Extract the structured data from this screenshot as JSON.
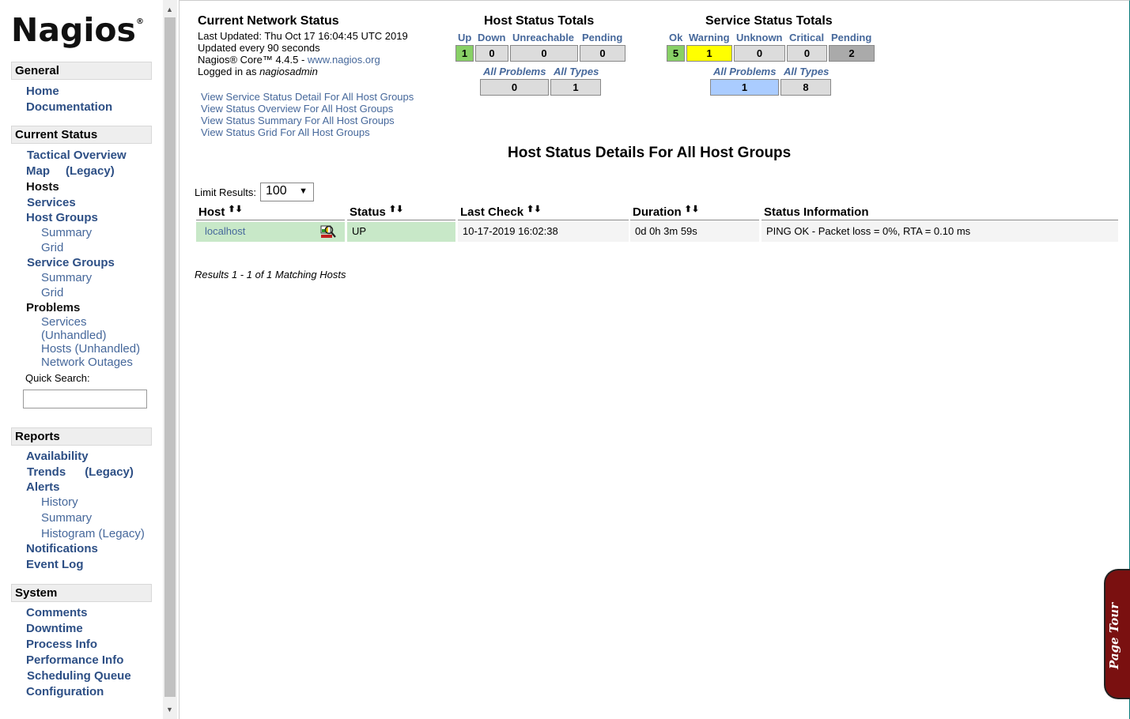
{
  "logo": {
    "text": "Nagios",
    "reg": "®"
  },
  "sidebar": {
    "general": {
      "header": "General",
      "items": [
        "Home",
        "Documentation"
      ]
    },
    "current_status": {
      "header": "Current Status",
      "tactical": "Tactical Overview",
      "map": "Map",
      "map_legacy": "(Legacy)",
      "hosts": "Hosts",
      "services": "Services",
      "host_groups": "Host Groups",
      "hg_summary": "Summary",
      "hg_grid": "Grid",
      "service_groups": "Service Groups",
      "sg_summary": "Summary",
      "sg_grid": "Grid",
      "problems": "Problems",
      "p_services": "Services",
      "p_unhandled": "(Unhandled)",
      "p_hosts": "Hosts (Unhandled)",
      "p_outages": "Network Outages",
      "quick_search": "Quick Search:"
    },
    "reports": {
      "header": "Reports",
      "availability": "Availability",
      "trends": "Trends",
      "trends_legacy": "(Legacy)",
      "alerts": "Alerts",
      "history": "History",
      "summary": "Summary",
      "histogram": "Histogram (Legacy)",
      "notifications": "Notifications",
      "event_log": "Event Log"
    },
    "system": {
      "header": "System",
      "comments": "Comments",
      "downtime": "Downtime",
      "process_info": "Process Info",
      "performance_info": "Performance Info",
      "scheduling_queue": "Scheduling Queue",
      "configuration": "Configuration"
    }
  },
  "info": {
    "title": "Current Network Status",
    "last_updated": "Last Updated: Thu Oct 17 16:04:45 UTC 2019",
    "update_interval": "Updated every 90 seconds",
    "version_prefix": "Nagios® Core™ 4.4.5 - ",
    "version_link": "www.nagios.org",
    "logged_prefix": "Logged in as ",
    "user": "nagiosadmin",
    "links": [
      "View Service Status Detail For All Host Groups",
      "View Status Overview For All Host Groups",
      "View Status Summary For All Host Groups",
      "View Status Grid For All Host Groups"
    ]
  },
  "host_totals": {
    "title": "Host Status Totals",
    "labels": {
      "up": "Up",
      "down": "Down",
      "unreachable": "Unreachable",
      "pending": "Pending"
    },
    "values": {
      "up": "1",
      "down": "0",
      "unreachable": "0",
      "pending": "0"
    },
    "all_problems_label": "All Problems",
    "all_types_label": "All Types",
    "all_problems": "0",
    "all_types": "1"
  },
  "service_totals": {
    "title": "Service Status Totals",
    "labels": {
      "ok": "Ok",
      "warning": "Warning",
      "unknown": "Unknown",
      "critical": "Critical",
      "pending": "Pending"
    },
    "values": {
      "ok": "5",
      "warning": "1",
      "unknown": "0",
      "critical": "0",
      "pending": "2"
    },
    "all_problems_label": "All Problems",
    "all_types_label": "All Types",
    "all_problems": "1",
    "all_types": "8"
  },
  "details": {
    "heading": "Host Status Details For All Host Groups",
    "limit_label": "Limit Results:",
    "limit_value": "100",
    "columns": {
      "host": "Host",
      "status": "Status",
      "last_check": "Last Check",
      "duration": "Duration",
      "info": "Status Information"
    },
    "rows": [
      {
        "host": "localhost",
        "status": "UP",
        "last_check": "10-17-2019 16:02:38",
        "duration": "0d 0h 3m 59s",
        "info": "PING OK - Packet loss = 0%, RTA = 0.10 ms"
      }
    ],
    "results": "Results 1 - 1 of 1 Matching Hosts"
  },
  "tour": "Page Tour",
  "colors": {
    "link": "#46689b",
    "nav": "#2d4f85",
    "up": "#88d066",
    "warning": "#ffff00",
    "pending": "#aaaaaa",
    "problems": "#aaccff",
    "tour": "#7a1010"
  }
}
